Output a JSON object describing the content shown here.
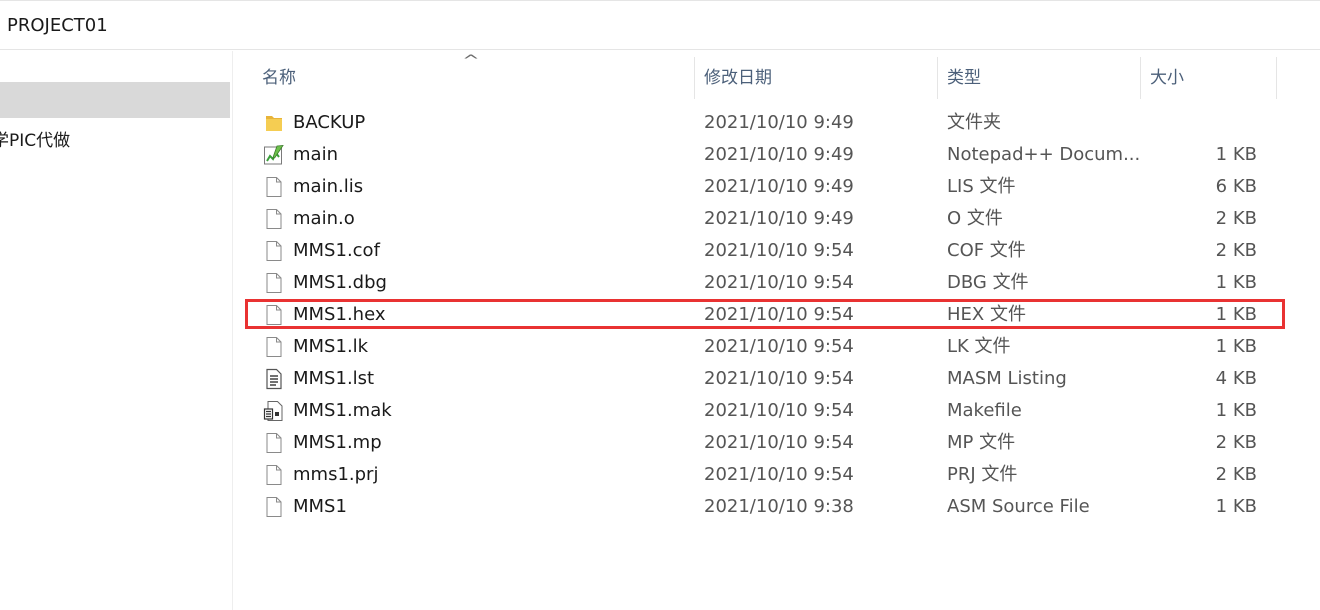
{
  "address": {
    "path": "PROJECT01"
  },
  "sidebar": {
    "partial_item_label": "学PIC代做"
  },
  "columns": {
    "name": "名称",
    "date": "修改日期",
    "type": "类型",
    "size": "大小"
  },
  "files": [
    {
      "name": "BACKUP",
      "date": "2021/10/10 9:49",
      "type": "文件夹",
      "size": "",
      "icon": "folder-icon"
    },
    {
      "name": "main",
      "date": "2021/10/10 9:49",
      "type": "Notepad++ Docum...",
      "size": "1 KB",
      "icon": "notepad-icon"
    },
    {
      "name": "main.lis",
      "date": "2021/10/10 9:49",
      "type": "LIS 文件",
      "size": "6 KB",
      "icon": "file-icon"
    },
    {
      "name": "main.o",
      "date": "2021/10/10 9:49",
      "type": "O 文件",
      "size": "2 KB",
      "icon": "file-icon"
    },
    {
      "name": "MMS1.cof",
      "date": "2021/10/10 9:54",
      "type": "COF 文件",
      "size": "2 KB",
      "icon": "file-icon"
    },
    {
      "name": "MMS1.dbg",
      "date": "2021/10/10 9:54",
      "type": "DBG 文件",
      "size": "1 KB",
      "icon": "file-icon"
    },
    {
      "name": "MMS1.hex",
      "date": "2021/10/10 9:54",
      "type": "HEX 文件",
      "size": "1 KB",
      "icon": "file-icon"
    },
    {
      "name": "MMS1.lk",
      "date": "2021/10/10 9:54",
      "type": "LK 文件",
      "size": "1 KB",
      "icon": "file-icon"
    },
    {
      "name": "MMS1.lst",
      "date": "2021/10/10 9:54",
      "type": "MASM Listing",
      "size": "4 KB",
      "icon": "listing-icon"
    },
    {
      "name": "MMS1.mak",
      "date": "2021/10/10 9:54",
      "type": "Makefile",
      "size": "1 KB",
      "icon": "makefile-icon"
    },
    {
      "name": "MMS1.mp",
      "date": "2021/10/10 9:54",
      "type": "MP 文件",
      "size": "2 KB",
      "icon": "file-icon"
    },
    {
      "name": "mms1.prj",
      "date": "2021/10/10 9:54",
      "type": "PRJ 文件",
      "size": "2 KB",
      "icon": "file-icon"
    },
    {
      "name": "MMS1",
      "date": "2021/10/10 9:38",
      "type": "ASM Source File",
      "size": "1 KB",
      "icon": "file-icon"
    }
  ],
  "highlight": {
    "color": "#e93232",
    "target": "MMS1.hex"
  }
}
